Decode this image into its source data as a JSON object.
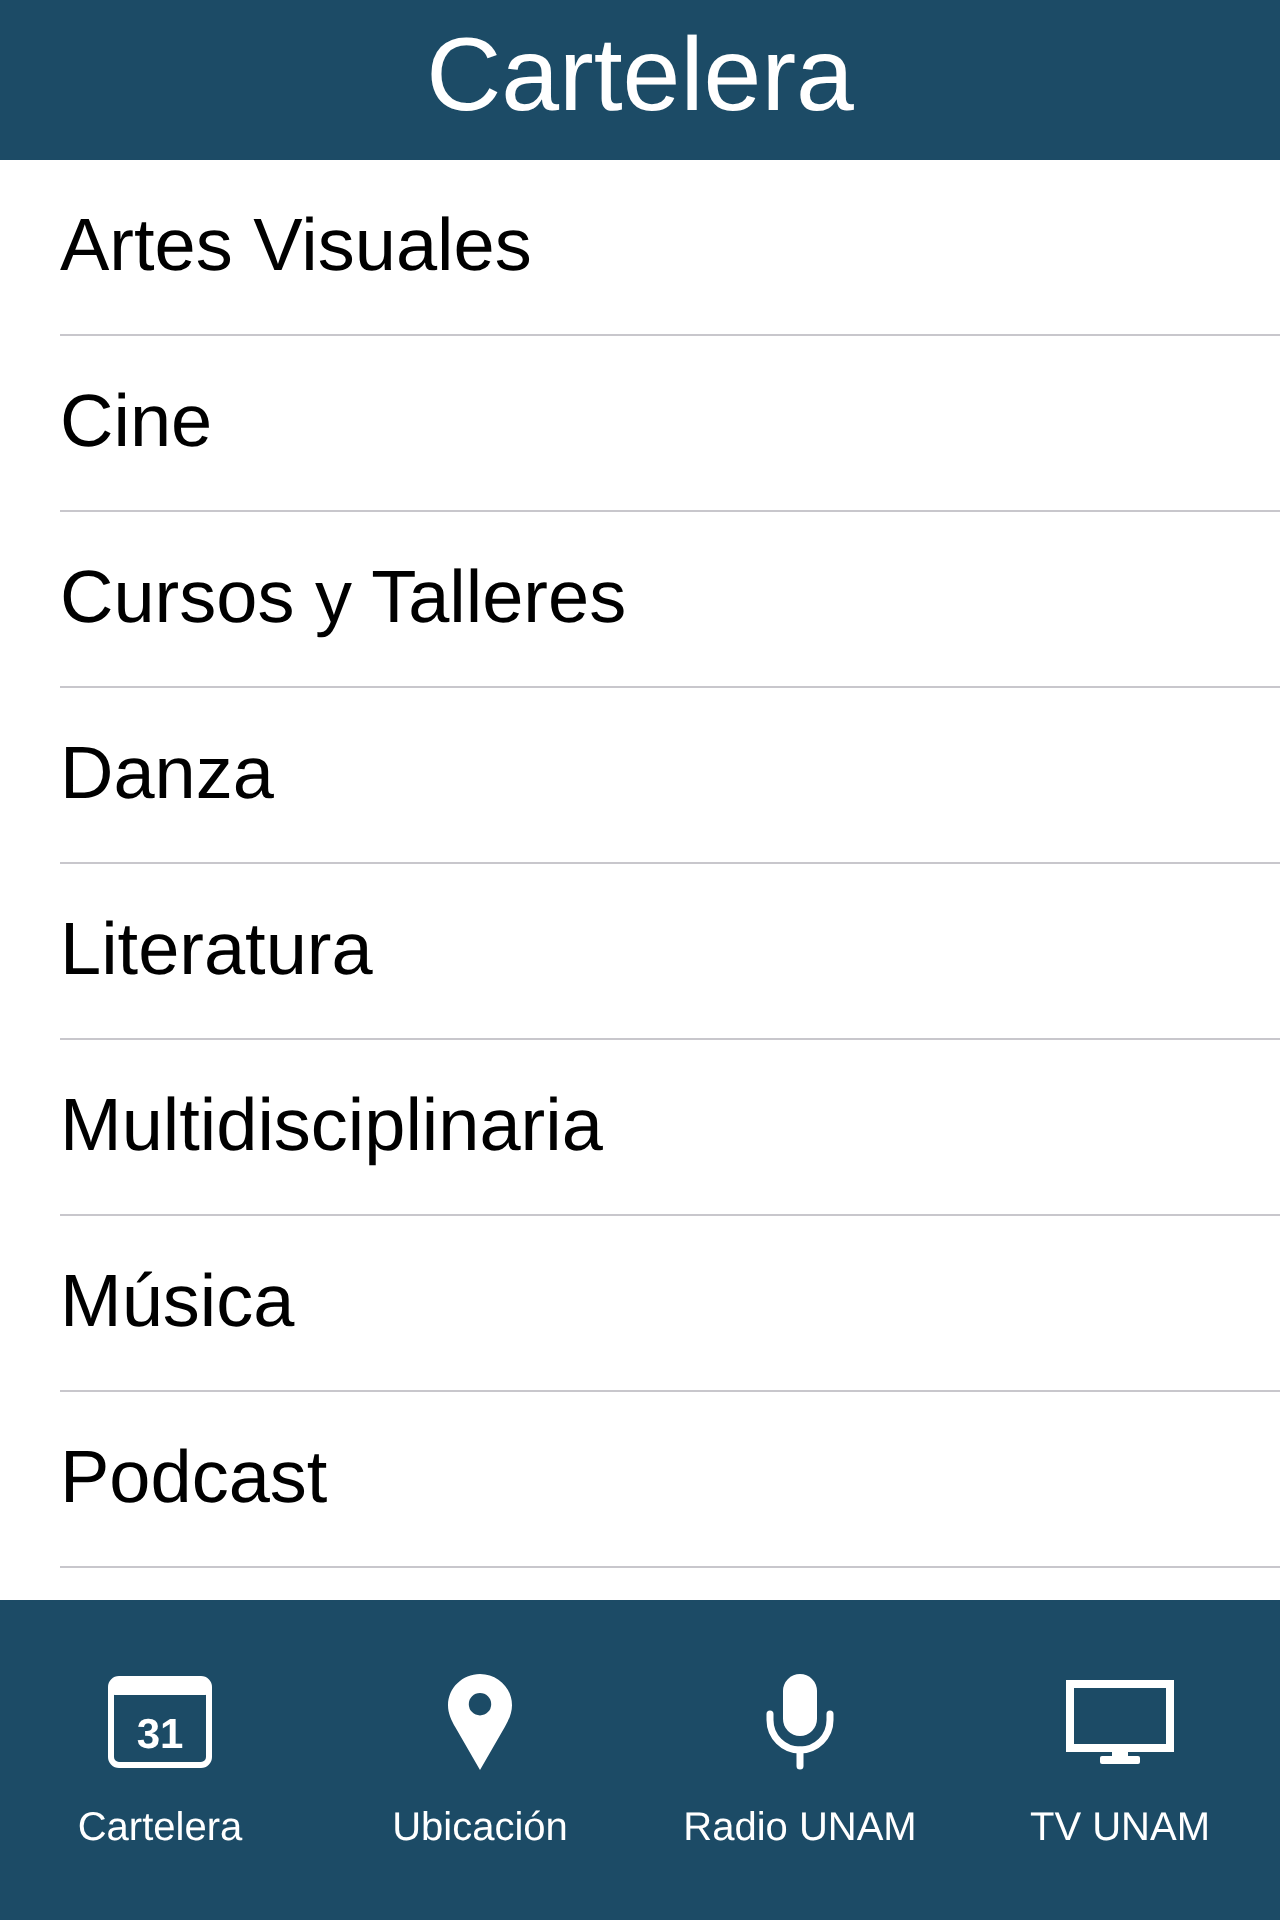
{
  "header": {
    "title": "Cartelera"
  },
  "categories": [
    "Artes Visuales",
    "Cine",
    "Cursos y Talleres",
    "Danza",
    "Literatura",
    "Multidisciplinaria",
    "Música",
    "Podcast"
  ],
  "tab_bar": [
    {
      "kind": "calendar",
      "label": "Cartelera",
      "day": "31"
    },
    {
      "kind": "pin",
      "label": "Ubicación"
    },
    {
      "kind": "mic",
      "label": "Radio UNAM"
    },
    {
      "kind": "tv",
      "label": "TV UNAM"
    }
  ]
}
